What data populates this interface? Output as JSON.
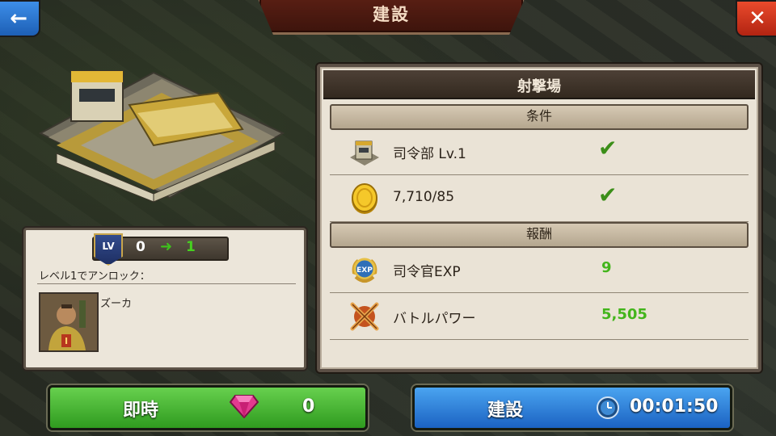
{
  "header": {
    "title": "建設",
    "back_glyph": "←",
    "close_glyph": "✕"
  },
  "info_panel": {
    "level_badge": "LV",
    "level_from": "0",
    "level_arrow": "➜",
    "level_to": "1",
    "unlock_label": "レベル1でアンロック：",
    "unit_name": "ズーカ",
    "portrait_rank": "I"
  },
  "main_panel": {
    "title": "射撃場",
    "requirements": {
      "header": "条件",
      "rows": [
        {
          "icon": "hq-building-icon",
          "label": "司令部 Lv.1",
          "check": "✔"
        },
        {
          "icon": "gold-coin-icon",
          "label": "7,710/85",
          "check": "✔"
        }
      ]
    },
    "rewards": {
      "header": "報酬",
      "rows": [
        {
          "icon": "exp-medal-icon",
          "label": "司令官EXP",
          "value": "9"
        },
        {
          "icon": "crossed-rifles-icon",
          "label": "バトルパワー",
          "value": "5,505"
        }
      ]
    }
  },
  "buttons": {
    "instant": {
      "label": "即時",
      "value": "0",
      "icon": "gem-icon"
    },
    "build": {
      "label": "建設",
      "value": "00:01:50",
      "icon": "clock-icon"
    }
  },
  "colors": {
    "instant_green": "#3fae2a",
    "build_blue": "#2a7ad6",
    "value_green": "#43b51c"
  }
}
